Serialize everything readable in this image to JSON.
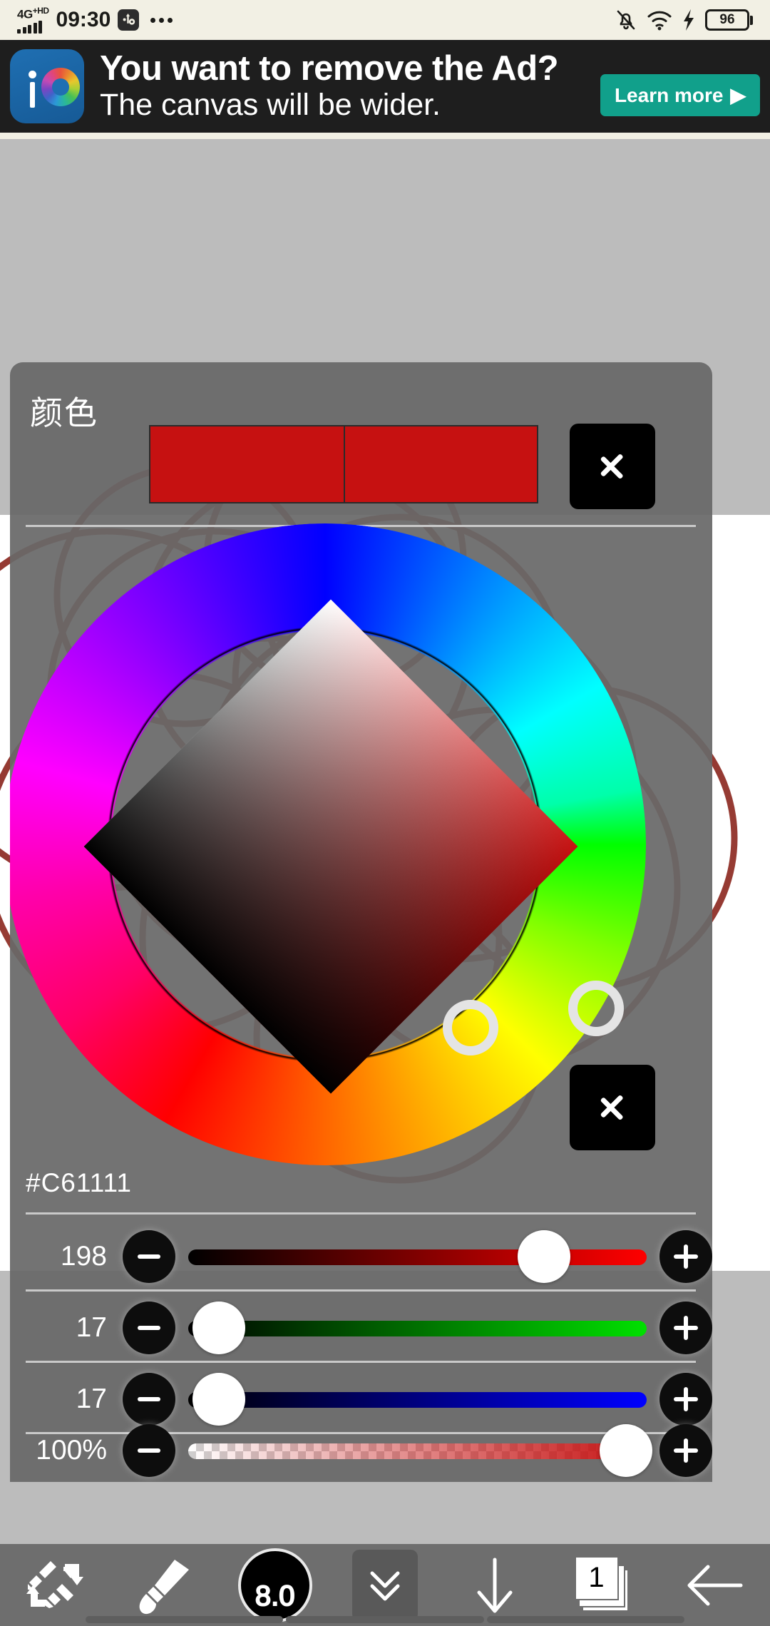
{
  "status_bar": {
    "network_type": "4G",
    "network_sup": "+HD",
    "time": "09:30",
    "usb_icon": "usb-debug-icon",
    "more_icon": "more-dots-icon",
    "mute_icon": "bell-muted-icon",
    "wifi_icon": "wifi-icon",
    "charging_icon": "lightning-bolt-icon",
    "battery_level": "96"
  },
  "ad": {
    "app_icon": "ibis-paint-app-icon",
    "headline": "You want to remove the Ad?",
    "subline": "The canvas will be wider.",
    "cta_label": "Learn more",
    "cta_arrow": "▶",
    "cta_color": "#11a08b",
    "background": "#1e1e1e"
  },
  "color_panel": {
    "title": "颜色",
    "swatch_primary": "#C61111",
    "swatch_secondary": "#C61111",
    "next_button_icon": "chevron-right-icon",
    "wheel_next_button_icon": "chevron-right-icon",
    "hex": "#C61111",
    "sv_marker_icon": "selector-ring-icon",
    "hue_marker_icon": "selector-ring-icon",
    "sliders": [
      {
        "name": "red",
        "value": "198",
        "pct": 77.6,
        "minus": "−",
        "plus": "+"
      },
      {
        "name": "green",
        "value": "17",
        "pct": 6.7,
        "minus": "−",
        "plus": "+"
      },
      {
        "name": "blue",
        "value": "17",
        "pct": 6.7,
        "minus": "−",
        "plus": "+"
      },
      {
        "name": "alpha",
        "value": "100%",
        "pct": 95.5,
        "minus": "−",
        "plus": "+"
      }
    ]
  },
  "toolbar": {
    "items": [
      {
        "name": "tool-swap",
        "icon": "pen-eraser-swap-icon",
        "label": ""
      },
      {
        "name": "brush",
        "icon": "paintbrush-icon",
        "label": ""
      },
      {
        "name": "brush-size",
        "icon": "brush-size-circle-icon",
        "label": "8.0"
      },
      {
        "name": "collapse-panel",
        "icon": "double-chevron-down-icon",
        "label": ""
      },
      {
        "name": "move-down",
        "icon": "arrow-down-icon",
        "label": ""
      },
      {
        "name": "layers",
        "icon": "layers-stack-icon",
        "label": "1"
      },
      {
        "name": "back",
        "icon": "arrow-left-icon",
        "label": ""
      }
    ]
  }
}
